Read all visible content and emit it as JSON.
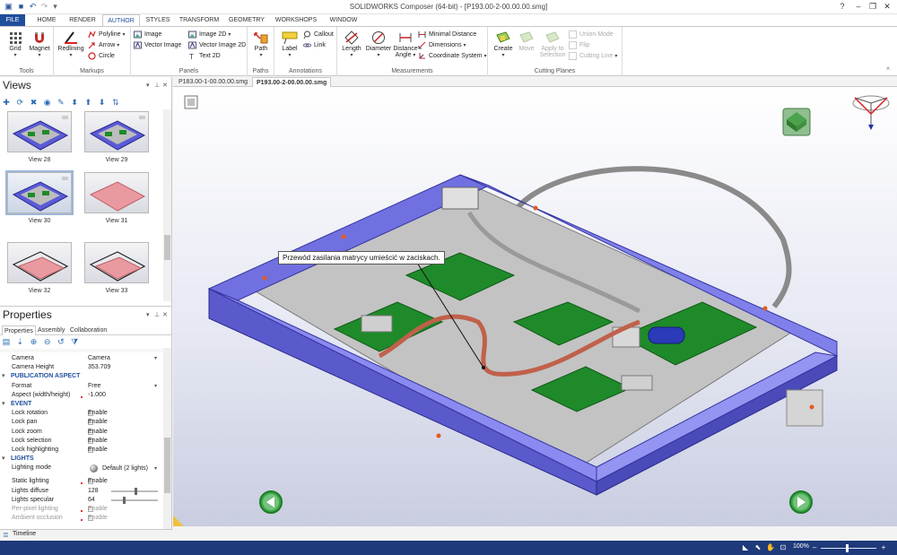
{
  "app": {
    "title": "SOLIDWORKS Composer (64-bit) - [P193.00-2-00.00.00.smg]",
    "window_controls": [
      "minimize-icon",
      "restore-icon",
      "close-icon"
    ]
  },
  "ribbon_tabs": [
    "FILE",
    "HOME",
    "RENDER",
    "AUTHOR",
    "STYLES",
    "TRANSFORM",
    "GEOMETRY",
    "WORKSHOPS",
    "WINDOW"
  ],
  "active_tab": "AUTHOR",
  "ribbon": {
    "tools": {
      "label": "Tools",
      "grid": "Grid",
      "magnet": "Magnet"
    },
    "markups": {
      "label": "Markups",
      "redlining": "Redlining",
      "polyline": "Polyline",
      "arrow": "Arrow",
      "circle": "Circle"
    },
    "panels": {
      "label": "Panels",
      "image": "Image",
      "vector_image": "Vector Image",
      "image_2d": "Image 2D",
      "vector_image_2d": "Vector Image 2D",
      "text_2d": "Text 2D"
    },
    "paths": {
      "label": "Paths",
      "path": "Path"
    },
    "annotations": {
      "label": "Annotations",
      "label_btn": "Label",
      "callout": "Callout",
      "link": "Link"
    },
    "measurements": {
      "label": "Measurements",
      "length": "Length",
      "diameter": "Diameter",
      "distance": "Distance",
      "angle": "Angle",
      "minimal_distance": "Minimal Distance",
      "dimensions": "Dimensions",
      "coordinate_system": "Coordinate System"
    },
    "cutting_planes": {
      "label": "Cutting Planes",
      "create": "Create",
      "move": "Move",
      "apply_to": "Apply to",
      "selection": "Selection",
      "union_mode": "Union Mode",
      "flip": "Flip",
      "cutting_line": "Cutting Line"
    }
  },
  "views_panel": {
    "title": "Views",
    "views": [
      {
        "label": "View 28"
      },
      {
        "label": "View 29"
      },
      {
        "label": "View 30",
        "selected": true
      },
      {
        "label": "View 31"
      },
      {
        "label": "View 32"
      },
      {
        "label": "View 33"
      }
    ]
  },
  "properties_panel": {
    "title": "Properties",
    "tabs": [
      "Properties",
      "Assembly",
      "Collaboration"
    ],
    "rows": [
      {
        "name": "Camera",
        "value": "Camera",
        "type": "dropdown"
      },
      {
        "name": "Camera Height",
        "value": "353.709",
        "type": "text"
      },
      {
        "name": "PUBLICATION ASPECT",
        "type": "section"
      },
      {
        "name": "Format",
        "value": "Free",
        "type": "dropdown"
      },
      {
        "name": "Aspect (width/height)",
        "value": "-1.000",
        "type": "text",
        "marked": true
      },
      {
        "name": "EVENT",
        "type": "section"
      },
      {
        "name": "Lock rotation",
        "value": "Enable",
        "type": "check"
      },
      {
        "name": "Lock pan",
        "value": "Enable",
        "type": "check"
      },
      {
        "name": "Lock zoom",
        "value": "Enable",
        "type": "check"
      },
      {
        "name": "Lock selection",
        "value": "Enable",
        "type": "check"
      },
      {
        "name": "Lock highlighting",
        "value": "Enable",
        "type": "check"
      },
      {
        "name": "LIGHTS",
        "type": "section"
      },
      {
        "name": "Lighting mode",
        "value": "Default (2 lights)",
        "type": "dropdown"
      },
      {
        "name": "Static lighting",
        "value": "Enable",
        "type": "check",
        "marked": true
      },
      {
        "name": "Lights diffuse",
        "value": "128",
        "type": "slider",
        "level": 0.5
      },
      {
        "name": "Lights specular",
        "value": "64",
        "type": "slider",
        "level": 0.25
      },
      {
        "name": "Per-pixel lighting",
        "value": "Enable",
        "type": "check",
        "disabled": true,
        "marked": true
      },
      {
        "name": "Ambient occlusion",
        "value": "Enable",
        "type": "check",
        "disabled": true,
        "marked": true
      }
    ]
  },
  "timeline": {
    "label": "Timeline"
  },
  "doc_tabs": [
    {
      "label": "P183.00-1-00.00.00.smg",
      "active": false
    },
    {
      "label": "P193.00-2-00.00.00.smg",
      "active": true
    }
  ],
  "viewport": {
    "callout_text": "Przewód zasilania matrycy umieścić w zaciskach."
  },
  "statusbar": {
    "zoom": "100%",
    "zoom_level": 0.45
  },
  "colors": {
    "accent": "#1f4e9b",
    "statusbar": "#1f3a7a",
    "frame": "#5858c8",
    "pcb": "#1f8a2a",
    "cable": "#c0614a",
    "nav_green": "#39a845"
  }
}
